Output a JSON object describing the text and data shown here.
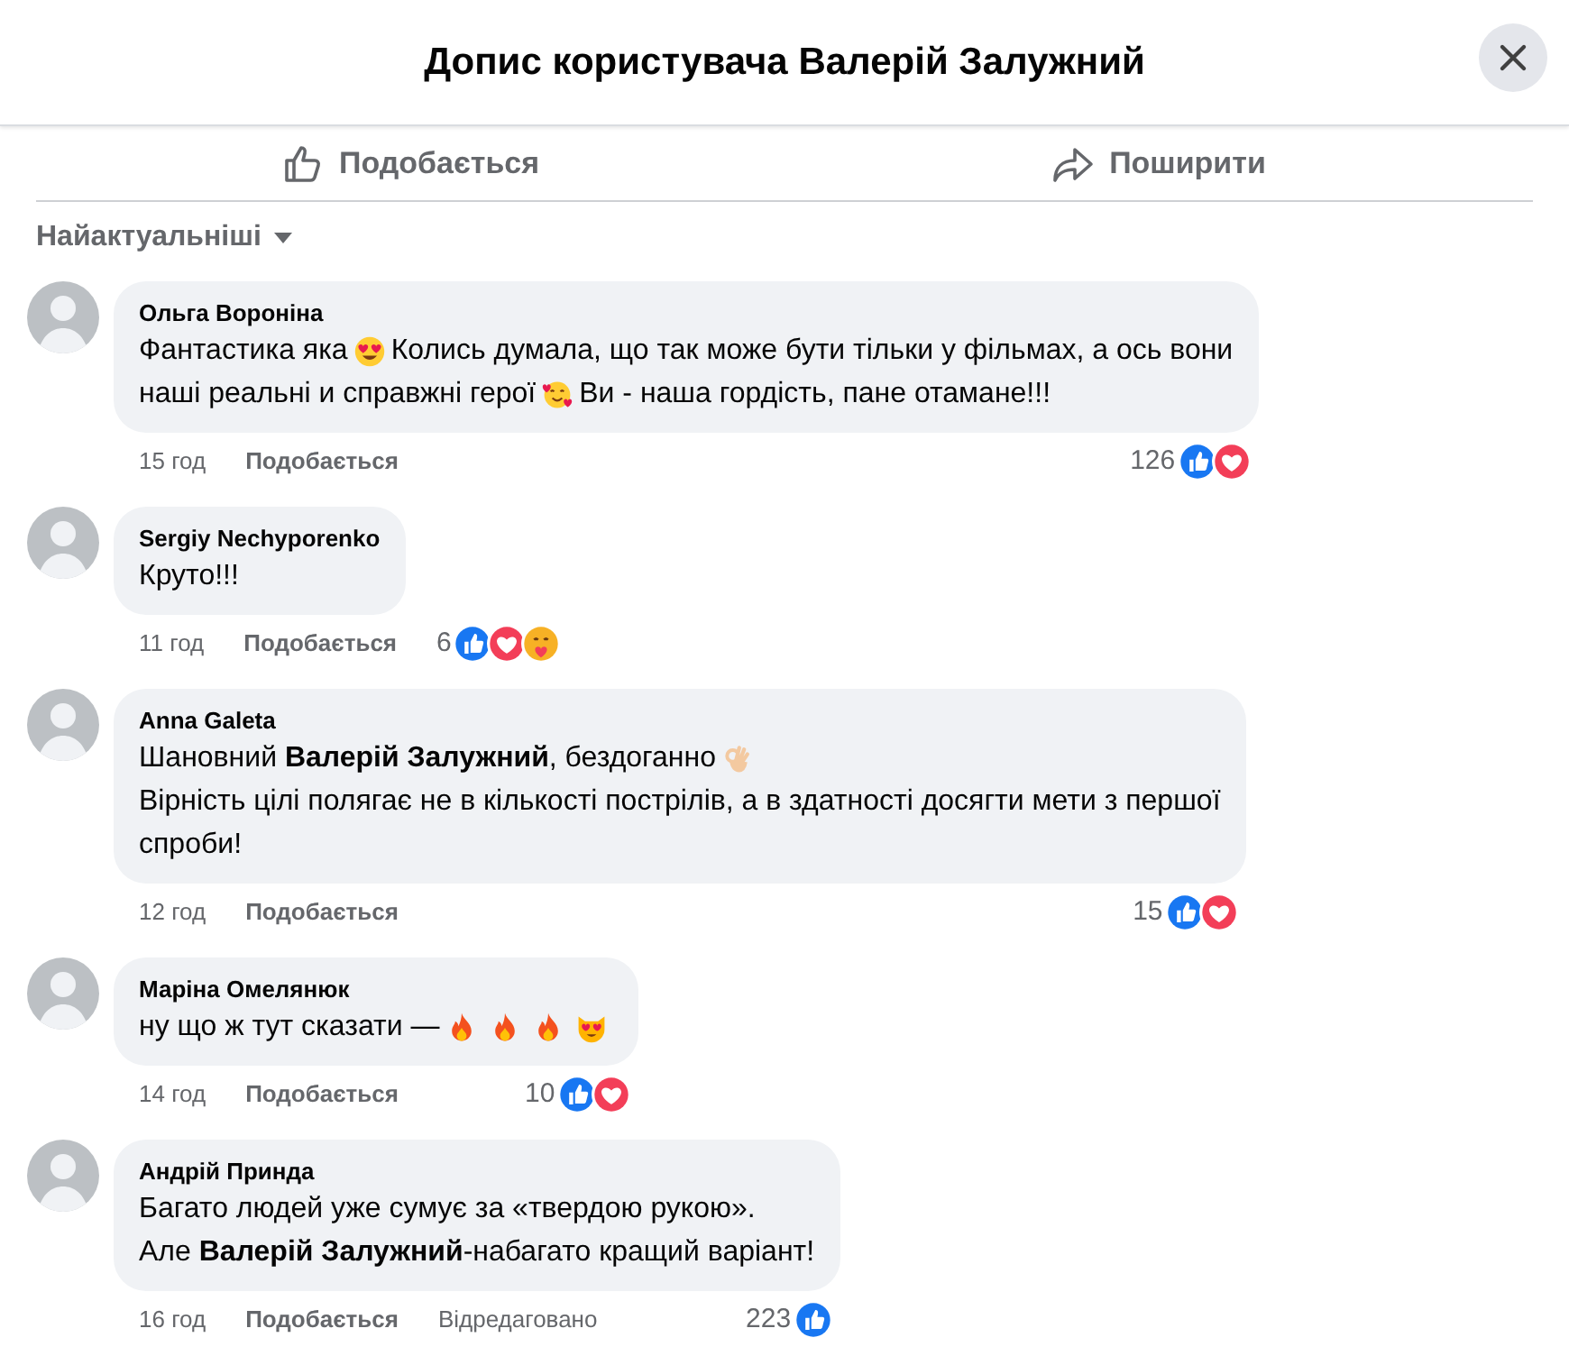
{
  "header": {
    "title": "Допис користувача Валерій Залужний"
  },
  "actions": [
    {
      "kind": "like",
      "label": "Подобається"
    },
    {
      "kind": "share",
      "label": "Поширити"
    }
  ],
  "sort": {
    "label": "Найактуальніші"
  },
  "comments": [
    {
      "author": "Ольга Вороніна",
      "lines": [
        [
          {
            "kind": "text",
            "text": "Фантастика яка"
          },
          {
            "kind": "heart-eyes"
          },
          {
            "kind": "text",
            "text": "Колись думала, що так може бути тільки у фільмах, а ось вони"
          }
        ],
        [
          {
            "kind": "text",
            "text": "наші реальні и справжні герої"
          },
          {
            "kind": "smiling-hearts"
          },
          {
            "kind": "text",
            "text": "Ви - наша гордість, пане отамане!!!"
          }
        ]
      ],
      "time": "15 год",
      "like_label": "Подобається",
      "reaction_count": "126",
      "reactions": [
        {
          "kind": "like"
        },
        {
          "kind": "love"
        }
      ]
    },
    {
      "author": "Sergiy Nechyporenko",
      "lines": [
        [
          {
            "kind": "text",
            "text": "Круто!!!"
          }
        ]
      ],
      "time": "11 год",
      "like_label": "Подобається",
      "reaction_count": "6",
      "reactions": [
        {
          "kind": "like"
        },
        {
          "kind": "love"
        },
        {
          "kind": "care"
        }
      ]
    },
    {
      "author": "Anna Galeta",
      "lines": [
        [
          {
            "kind": "text",
            "text": "Шановний **Валерій Залужний**, бездоганно"
          },
          {
            "kind": "ok-hand"
          }
        ],
        [
          {
            "kind": "text",
            "text": "Вірність цілі полягає не в кількості пострілів, а в здатності досягти мети з першої"
          }
        ],
        [
          {
            "kind": "text",
            "text": "спроби!"
          }
        ]
      ],
      "time": "12 год",
      "like_label": "Подобається",
      "reaction_count": "15",
      "reactions": [
        {
          "kind": "like"
        },
        {
          "kind": "love"
        }
      ]
    },
    {
      "author": "Маріна Омелянюк",
      "lines": [
        [
          {
            "kind": "text",
            "text": "ну що ж тут сказати —"
          },
          {
            "kind": "fire"
          },
          {
            "kind": "fire"
          },
          {
            "kind": "fire"
          },
          {
            "kind": "heart-eyes-cat"
          }
        ]
      ],
      "time": "14 год",
      "like_label": "Подобається",
      "reaction_count": "10",
      "reactions": [
        {
          "kind": "like"
        },
        {
          "kind": "love"
        }
      ]
    },
    {
      "author": "Андрій Принда",
      "lines": [
        [
          {
            "kind": "text",
            "text": "Багато людей уже сумує за «твердою рукою»."
          }
        ],
        [
          {
            "kind": "text",
            "text": "Але **Валерій Залужний**-набагато кращий варіант!"
          }
        ]
      ],
      "time": "16 год",
      "like_label": "Подобається",
      "edited_label": "Відредаговано",
      "reaction_count": "223",
      "reactions": [
        {
          "kind": "like"
        }
      ]
    }
  ]
}
